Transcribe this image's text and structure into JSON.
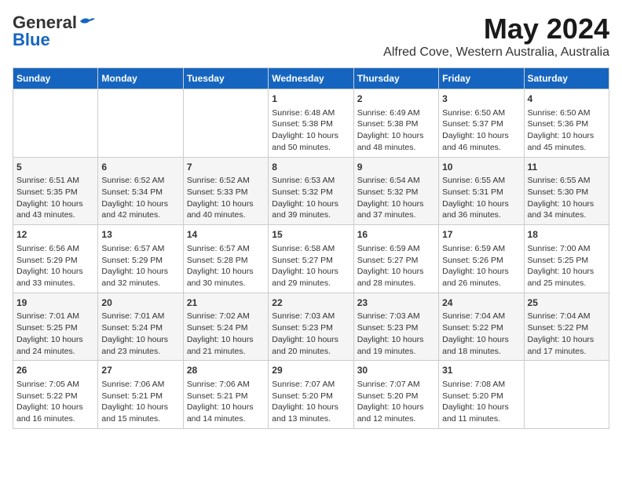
{
  "logo": {
    "general": "General",
    "blue": "Blue"
  },
  "title": "May 2024",
  "subtitle": "Alfred Cove, Western Australia, Australia",
  "headers": [
    "Sunday",
    "Monday",
    "Tuesday",
    "Wednesday",
    "Thursday",
    "Friday",
    "Saturday"
  ],
  "weeks": [
    [
      {
        "day": "",
        "info": ""
      },
      {
        "day": "",
        "info": ""
      },
      {
        "day": "",
        "info": ""
      },
      {
        "day": "1",
        "info": "Sunrise: 6:48 AM\nSunset: 5:38 PM\nDaylight: 10 hours\nand 50 minutes."
      },
      {
        "day": "2",
        "info": "Sunrise: 6:49 AM\nSunset: 5:38 PM\nDaylight: 10 hours\nand 48 minutes."
      },
      {
        "day": "3",
        "info": "Sunrise: 6:50 AM\nSunset: 5:37 PM\nDaylight: 10 hours\nand 46 minutes."
      },
      {
        "day": "4",
        "info": "Sunrise: 6:50 AM\nSunset: 5:36 PM\nDaylight: 10 hours\nand 45 minutes."
      }
    ],
    [
      {
        "day": "5",
        "info": "Sunrise: 6:51 AM\nSunset: 5:35 PM\nDaylight: 10 hours\nand 43 minutes."
      },
      {
        "day": "6",
        "info": "Sunrise: 6:52 AM\nSunset: 5:34 PM\nDaylight: 10 hours\nand 42 minutes."
      },
      {
        "day": "7",
        "info": "Sunrise: 6:52 AM\nSunset: 5:33 PM\nDaylight: 10 hours\nand 40 minutes."
      },
      {
        "day": "8",
        "info": "Sunrise: 6:53 AM\nSunset: 5:32 PM\nDaylight: 10 hours\nand 39 minutes."
      },
      {
        "day": "9",
        "info": "Sunrise: 6:54 AM\nSunset: 5:32 PM\nDaylight: 10 hours\nand 37 minutes."
      },
      {
        "day": "10",
        "info": "Sunrise: 6:55 AM\nSunset: 5:31 PM\nDaylight: 10 hours\nand 36 minutes."
      },
      {
        "day": "11",
        "info": "Sunrise: 6:55 AM\nSunset: 5:30 PM\nDaylight: 10 hours\nand 34 minutes."
      }
    ],
    [
      {
        "day": "12",
        "info": "Sunrise: 6:56 AM\nSunset: 5:29 PM\nDaylight: 10 hours\nand 33 minutes."
      },
      {
        "day": "13",
        "info": "Sunrise: 6:57 AM\nSunset: 5:29 PM\nDaylight: 10 hours\nand 32 minutes."
      },
      {
        "day": "14",
        "info": "Sunrise: 6:57 AM\nSunset: 5:28 PM\nDaylight: 10 hours\nand 30 minutes."
      },
      {
        "day": "15",
        "info": "Sunrise: 6:58 AM\nSunset: 5:27 PM\nDaylight: 10 hours\nand 29 minutes."
      },
      {
        "day": "16",
        "info": "Sunrise: 6:59 AM\nSunset: 5:27 PM\nDaylight: 10 hours\nand 28 minutes."
      },
      {
        "day": "17",
        "info": "Sunrise: 6:59 AM\nSunset: 5:26 PM\nDaylight: 10 hours\nand 26 minutes."
      },
      {
        "day": "18",
        "info": "Sunrise: 7:00 AM\nSunset: 5:25 PM\nDaylight: 10 hours\nand 25 minutes."
      }
    ],
    [
      {
        "day": "19",
        "info": "Sunrise: 7:01 AM\nSunset: 5:25 PM\nDaylight: 10 hours\nand 24 minutes."
      },
      {
        "day": "20",
        "info": "Sunrise: 7:01 AM\nSunset: 5:24 PM\nDaylight: 10 hours\nand 23 minutes."
      },
      {
        "day": "21",
        "info": "Sunrise: 7:02 AM\nSunset: 5:24 PM\nDaylight: 10 hours\nand 21 minutes."
      },
      {
        "day": "22",
        "info": "Sunrise: 7:03 AM\nSunset: 5:23 PM\nDaylight: 10 hours\nand 20 minutes."
      },
      {
        "day": "23",
        "info": "Sunrise: 7:03 AM\nSunset: 5:23 PM\nDaylight: 10 hours\nand 19 minutes."
      },
      {
        "day": "24",
        "info": "Sunrise: 7:04 AM\nSunset: 5:22 PM\nDaylight: 10 hours\nand 18 minutes."
      },
      {
        "day": "25",
        "info": "Sunrise: 7:04 AM\nSunset: 5:22 PM\nDaylight: 10 hours\nand 17 minutes."
      }
    ],
    [
      {
        "day": "26",
        "info": "Sunrise: 7:05 AM\nSunset: 5:22 PM\nDaylight: 10 hours\nand 16 minutes."
      },
      {
        "day": "27",
        "info": "Sunrise: 7:06 AM\nSunset: 5:21 PM\nDaylight: 10 hours\nand 15 minutes."
      },
      {
        "day": "28",
        "info": "Sunrise: 7:06 AM\nSunset: 5:21 PM\nDaylight: 10 hours\nand 14 minutes."
      },
      {
        "day": "29",
        "info": "Sunrise: 7:07 AM\nSunset: 5:20 PM\nDaylight: 10 hours\nand 13 minutes."
      },
      {
        "day": "30",
        "info": "Sunrise: 7:07 AM\nSunset: 5:20 PM\nDaylight: 10 hours\nand 12 minutes."
      },
      {
        "day": "31",
        "info": "Sunrise: 7:08 AM\nSunset: 5:20 PM\nDaylight: 10 hours\nand 11 minutes."
      },
      {
        "day": "",
        "info": ""
      }
    ]
  ]
}
